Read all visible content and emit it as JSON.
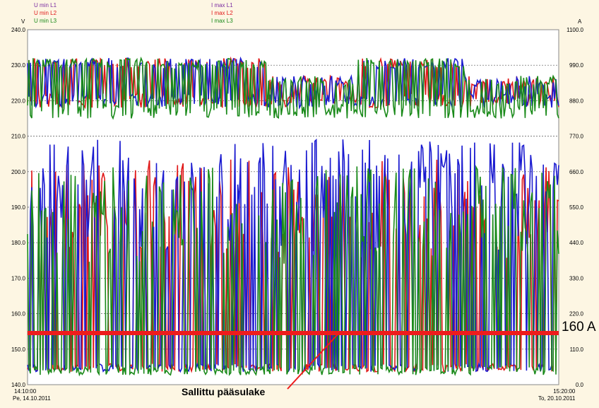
{
  "legend_left": [
    {
      "label": "U min L1",
      "color": "#7a2aa0"
    },
    {
      "label": "U min L2",
      "color": "#e01818"
    },
    {
      "label": "U min L3",
      "color": "#1a8a1a"
    }
  ],
  "legend_right": [
    {
      "label": "I max L1",
      "color": "#7a2aa0"
    },
    {
      "label": "I max L2",
      "color": "#e01818"
    },
    {
      "label": "I max L3",
      "color": "#1a8a1a"
    }
  ],
  "units": {
    "left": "V",
    "right": "A"
  },
  "x_start": {
    "time": "14:10:00",
    "date": "Pe, 14.10.2011"
  },
  "x_end": {
    "time": "15:20:00",
    "date": "To, 20.10.2011"
  },
  "annotation": {
    "fuse_text": "Sallittu pääsulake",
    "fuse_value": "160 A",
    "fuse_current": 160,
    "color": "#ee1c1c"
  },
  "chart_data": {
    "type": "line",
    "x": [
      "14:10:00 Pe, 14.10.2011",
      "15:20:00 To, 20.10.2011"
    ],
    "y_left": {
      "min": 140,
      "max": 240,
      "ticks": [
        "140.0",
        "150.0",
        "160.0",
        "170.0",
        "180.0",
        "190.0",
        "200.0",
        "210.0",
        "220.0",
        "230.0",
        "240.0"
      ]
    },
    "y_right": {
      "min": 0,
      "max": 1100,
      "ticks": [
        "0.0",
        "110.0",
        "220.0",
        "330.0",
        "440.0",
        "550.0",
        "660.0",
        "770.0",
        "880.0",
        "990.0",
        "1100.0"
      ]
    },
    "dashed_gridlines_left": [
      150,
      160,
      170,
      180,
      190,
      200,
      210,
      220,
      230
    ],
    "series": [
      {
        "name": "U min L1",
        "color": "#1a1ad0",
        "axis": "left",
        "typical_range": [
          218,
          233
        ]
      },
      {
        "name": "U min L2",
        "color": "#e01818",
        "axis": "left",
        "typical_range": [
          218,
          233
        ]
      },
      {
        "name": "U min L3",
        "color": "#1a8a1a",
        "axis": "left",
        "typical_range": [
          215,
          234
        ]
      },
      {
        "name": "I max L1",
        "color": "#1a1ad0",
        "axis": "right",
        "typical_range": [
          40,
          760
        ]
      },
      {
        "name": "I max L2",
        "color": "#e01818",
        "axis": "right",
        "typical_range": [
          40,
          700
        ]
      },
      {
        "name": "I max L3",
        "color": "#1a8a1a",
        "axis": "right",
        "typical_range": [
          30,
          680
        ]
      }
    ]
  }
}
